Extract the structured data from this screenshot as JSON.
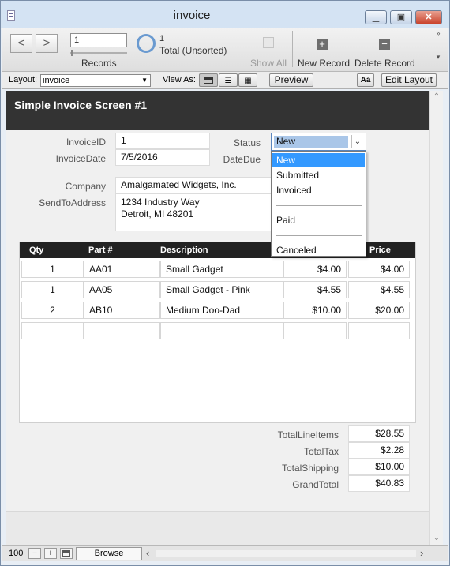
{
  "window": {
    "title": "invoice"
  },
  "toolbar": {
    "record_value": "1",
    "records_label": "Records",
    "found_count": "1",
    "sort_status": "Total (Unsorted)",
    "show_all_label": "Show All",
    "new_record_label": "New Record",
    "delete_record_label": "Delete Record"
  },
  "layout_bar": {
    "layout_label": "Layout:",
    "layout_value": "invoice",
    "view_as_label": "View As:",
    "preview_label": "Preview",
    "aa_label": "Aa",
    "edit_layout_label": "Edit Layout"
  },
  "form": {
    "header_title": "Simple Invoice Screen #1",
    "invoice_id_label": "InvoiceID",
    "invoice_id_value": "1",
    "invoice_date_label": "InvoiceDate",
    "invoice_date_value": "7/5/2016",
    "status_label": "Status",
    "status_value": "New",
    "date_due_label": "DateDue",
    "company_label": "Company",
    "company_value": "Amalgamated Widgets, Inc.",
    "send_to_label": "SendToAddress",
    "address_line1": "1234 Industry Way",
    "address_line2": "Detroit, MI 48201"
  },
  "status_dropdown": {
    "options": [
      "New",
      "Submitted",
      "Invoiced",
      "Paid",
      "Canceled"
    ],
    "selected_index": 0
  },
  "line_items": {
    "headers": {
      "qty": "Qty",
      "part": "Part #",
      "description": "Description",
      "price": "Price"
    },
    "rows": [
      {
        "qty": "1",
        "part": "AA01",
        "description": "Small Gadget",
        "unit_price": "$4.00",
        "price": "$4.00"
      },
      {
        "qty": "1",
        "part": "AA05",
        "description": "Small Gadget - Pink",
        "unit_price": "$4.55",
        "price": "$4.55"
      },
      {
        "qty": "2",
        "part": "AB10",
        "description": "Medium Doo-Dad",
        "unit_price": "$10.00",
        "price": "$20.00"
      }
    ]
  },
  "totals": {
    "line_items_label": "TotalLineItems",
    "line_items_value": "$28.55",
    "tax_label": "TotalTax",
    "tax_value": "$2.28",
    "shipping_label": "TotalShipping",
    "shipping_value": "$10.00",
    "grand_label": "GrandTotal",
    "grand_value": "$40.83"
  },
  "status_bar": {
    "zoom": "100",
    "mode": "Browse"
  },
  "colors": {
    "header_bg": "#333333",
    "dropdown_highlight": "#3399ff",
    "table_header_bg": "#222222"
  }
}
